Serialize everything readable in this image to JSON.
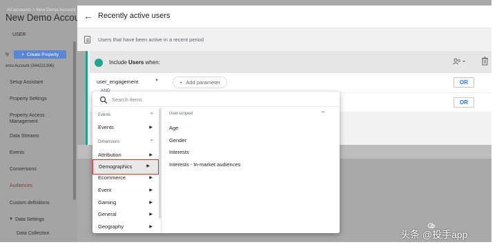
{
  "sidebar": {
    "breadcrumb": "All accounts > New Demo Account",
    "account_name": "New Demo Account",
    "section_label": "USER",
    "create_property_prefix": "ty",
    "create_property_label": "Create Property",
    "account_id": "emo Account (344221306)",
    "items": [
      {
        "label": "Setup Assistant"
      },
      {
        "label": "Property Settings"
      },
      {
        "label": "Property Access Management"
      },
      {
        "label": "Data Streams"
      },
      {
        "label": "Events"
      },
      {
        "label": "Conversions"
      },
      {
        "label": "Audiences"
      },
      {
        "label": "Custom definitions"
      },
      {
        "label": "Data Settings"
      },
      {
        "label": "Data Collection"
      }
    ]
  },
  "header": {
    "title": "Recently active users"
  },
  "description": "Users that have been active in a recent period",
  "condition": {
    "include_prefix": "Include",
    "include_bold": "Users",
    "include_suffix": "when:",
    "field_name": "user_engagement",
    "and_label": "AND",
    "add_parameter_label": "Add parameter",
    "or_label_1": "OR",
    "or_label_2": "OR"
  },
  "dropdown": {
    "search_placeholder": "Search items",
    "events_header": "Events",
    "events_item": "Events",
    "dimensions_header": "Dimensions",
    "categories": [
      {
        "label": "Attribution"
      },
      {
        "label": "Demographics"
      },
      {
        "label": "Ecommerce"
      },
      {
        "label": "Event"
      },
      {
        "label": "Gaming"
      },
      {
        "label": "General"
      },
      {
        "label": "Geography"
      }
    ],
    "selected_category": "Demographics",
    "right_header": "User-scoped",
    "right_items": [
      {
        "label": "Age"
      },
      {
        "label": "Gender"
      },
      {
        "label": "Interests"
      },
      {
        "label": "Interests - In-market audiences"
      }
    ]
  },
  "watermark": {
    "text": "头条 @投手app"
  },
  "colors": {
    "accent_teal": "#21a593",
    "selection_red": "#d93025",
    "link_blue": "#1a73e8"
  }
}
